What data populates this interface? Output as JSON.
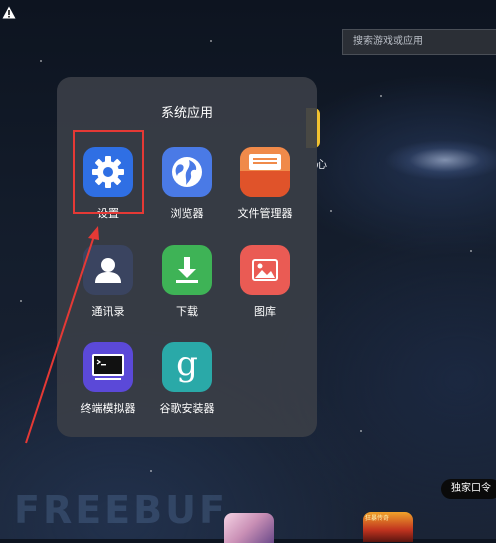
{
  "search": {
    "placeholder": "搜索游戏或应用"
  },
  "folder": {
    "title": "系统应用",
    "apps": [
      {
        "label": "设置",
        "icon": "gear-icon",
        "color": "#2f6fe4"
      },
      {
        "label": "浏览器",
        "icon": "globe-icon",
        "color": "#4a7ae6"
      },
      {
        "label": "文件管理器",
        "icon": "file-manager-icon",
        "color": "#e65a2c"
      },
      {
        "label": "通讯录",
        "icon": "contacts-icon",
        "color": "#3a4460"
      },
      {
        "label": "下载",
        "icon": "download-icon",
        "color": "#3eb356"
      },
      {
        "label": "图库",
        "icon": "gallery-icon",
        "color": "#ea5b54"
      },
      {
        "label": "终端模拟器",
        "icon": "terminal-icon",
        "color": "#5b49d8"
      },
      {
        "label": "谷歌安装器",
        "icon": "google-installer-icon",
        "color": "#2aa9a8"
      }
    ]
  },
  "background": {
    "partial_label": "心"
  },
  "bottom": {
    "badge": "独家口令",
    "watermark": "FREEBUF",
    "promo_thumb_text": "狂暴传奇"
  },
  "colors": {
    "highlight": "#e53935",
    "annotation_arrow": "#e53935",
    "folder_bg": "#3a3e46"
  }
}
